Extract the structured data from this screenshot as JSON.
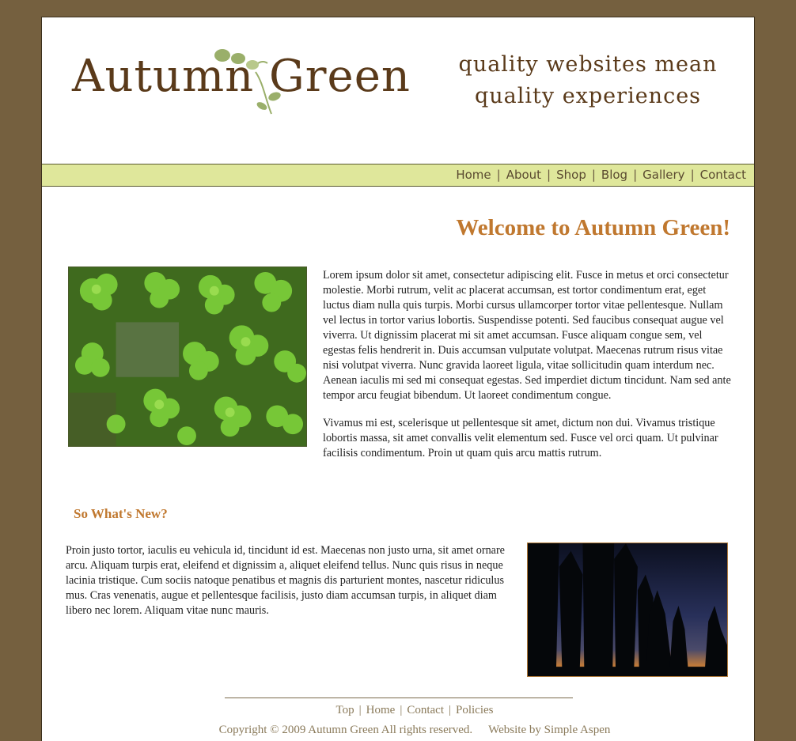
{
  "header": {
    "logo_text": "Autumn Green",
    "tagline_line1": "quality websites mean",
    "tagline_line2": "quality experiences"
  },
  "nav": {
    "items": [
      "Home",
      "About",
      "Shop",
      "Blog",
      "Gallery",
      "Contact"
    ]
  },
  "main": {
    "title": "Welcome to Autumn Green!",
    "paragraph1": "Lorem ipsum dolor sit amet, consectetur adipiscing elit. Fusce in metus et orci consectetur molestie. Morbi rutrum, velit ac placerat accumsan, est tortor condimentum erat, eget luctus diam nulla quis turpis. Morbi cursus ullamcorper tortor vitae pellentesque. Nullam vel lectus in tortor varius lobortis. Suspendisse potenti. Sed faucibus consequat augue vel viverra. Ut dignissim placerat mi sit amet accumsan. Fusce aliquam congue sem, vel egestas felis hendrerit in. Duis accumsan vulputate volutpat. Maecenas rutrum risus vitae nisi volutpat viverra. Nunc gravida laoreet ligula, vitae sollicitudin quam interdum nec. Aenean iaculis mi sed mi consequat egestas. Sed imperdiet dictum tincidunt. Nam sed ante tempor arcu feugiat bibendum. Ut laoreet condimentum congue.",
    "paragraph2": "Vivamus mi est, scelerisque ut pellentesque sit amet, dictum non dui. Vivamus tristique lobortis massa, sit amet convallis velit elementum sed. Fusce vel orci quam. Ut pulvinar facilisis condimentum. Proin ut quam quis arcu mattis rutrum."
  },
  "news": {
    "title": "So What's New?",
    "paragraph": "Proin justo tortor, iaculis eu vehicula id, tincidunt id est. Maecenas non justo urna, sit amet ornare arcu. Aliquam turpis erat, eleifend et dignissim a, aliquet eleifend tellus. Nunc quis risus in neque lacinia tristique. Cum sociis natoque penatibus et magnis dis parturient montes, nascetur ridiculus mus. Cras venenatis, augue et pellentesque facilisis, justo diam accumsan turpis, in aliquet diam libero nec lorem. Aliquam vitae nunc mauris."
  },
  "footer": {
    "links": [
      "Top",
      "Home",
      "Contact",
      "Policies"
    ],
    "copyright": "Copyright © 2009 Autumn Green All rights reserved.",
    "credit": "Website by Simple Aspen"
  },
  "colors": {
    "background": "#75603f",
    "nav_bar": "#dfe79b",
    "heading": "#c0782f",
    "logo": "#5a3a1a"
  },
  "icons": [
    "vine-leaf-logo-icon",
    "clover-photo",
    "forest-sunset-photo"
  ]
}
